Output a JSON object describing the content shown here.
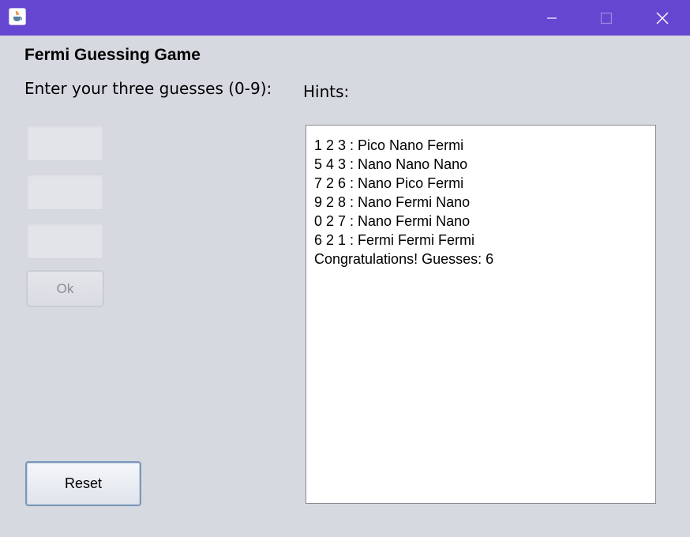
{
  "window": {
    "app_icon": "java-coffee-icon",
    "controls": [
      "minimize-icon",
      "maximize-icon",
      "close-icon"
    ],
    "titlebar_color": "#6546d1"
  },
  "game": {
    "title": "Fermi Guessing Game",
    "prompt": "Enter your three guesses (0-9):",
    "hints_label": "Hints:",
    "guess_values": [
      "",
      "",
      ""
    ],
    "ok_label": "Ok",
    "reset_label": "Reset"
  },
  "hints": [
    "1 2 3 : Pico Nano Fermi",
    "5 4 3 : Nano Nano Nano",
    "7 2 6 : Nano Pico Fermi",
    "9 2 8 : Nano Fermi Nano",
    "0 2 7 : Nano Fermi Nano",
    "6 2 1 : Fermi Fermi Fermi",
    "Congratulations! Guesses: 6"
  ]
}
